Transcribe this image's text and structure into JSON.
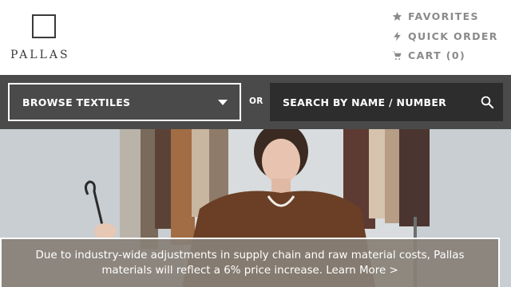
{
  "brand": {
    "name": "PALLAS"
  },
  "utility_nav": [
    {
      "label": "FAVORITES",
      "icon": "star-icon"
    },
    {
      "label": "QUICK ORDER",
      "icon": "lightning-icon"
    },
    {
      "label": "CART (0)",
      "icon": "cart-icon"
    }
  ],
  "navbar": {
    "browse_label": "BROWSE TEXTILES",
    "or_label": "OR",
    "search_label": "SEARCH BY NAME / NUMBER"
  },
  "notice": {
    "text": "Due to industry-wide adjustments in supply chain and raw material costs, Pallas materials will reflect a 6% price increase. Learn More >"
  },
  "colors": {
    "header_bg": "#ffffff",
    "navbar_bg": "#4a4a4a",
    "search_bg": "#2d2d2d",
    "utility_text": "#8a8a8a",
    "notice_bg": "#888076"
  }
}
